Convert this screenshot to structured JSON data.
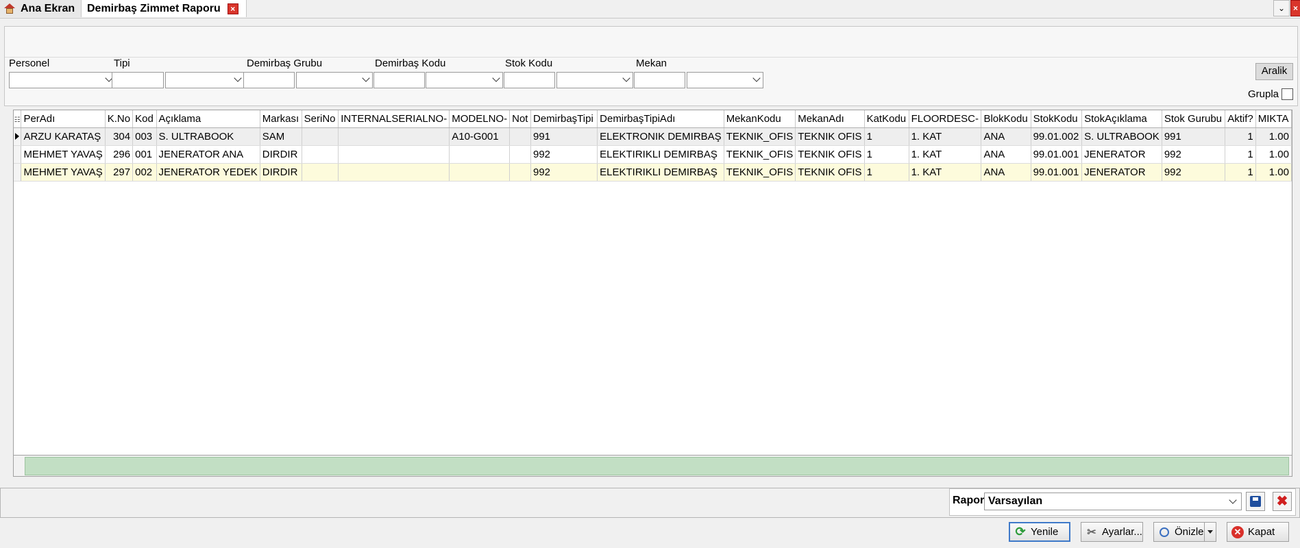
{
  "tabs": {
    "home_label": "Ana Ekran",
    "active_label": "Demirbaş Zimmet Raporu"
  },
  "filters": {
    "personel_label": "Personel",
    "tipi_label": "Tipi",
    "demirbas_grubu_label": "Demirbaş Grubu",
    "demirbas_kodu_label": "Demirbaş Kodu",
    "stok_kodu_label": "Stok Kodu",
    "mekan_label": "Mekan",
    "aralik_label": "Aralik",
    "grupla_label": "Grupla"
  },
  "grid": {
    "columns": [
      "PerAdı",
      "K.No",
      "Kod",
      "Açıklama",
      "Markası",
      "SeriNo",
      "INTERNALSERIALNO-",
      "MODELNO-",
      "Not",
      "DemirbaşTipi",
      "DemirbaşTipiAdı",
      "MekanKodu",
      "MekanAdı",
      "KatKodu",
      "FLOORDESC-",
      "BlokKodu",
      "StokKodu",
      "StokAçıklama",
      "Stok Gurubu",
      "Aktif?",
      "MIKTA"
    ],
    "rows": [
      [
        "ARZU KARATAŞ",
        "304",
        "003",
        "S. ULTRABOOK",
        "SAM",
        "",
        "",
        "A10-G001",
        "",
        "991",
        "ELEKTRONIK DEMIRBAŞ",
        "TEKNIK_OFIS",
        "TEKNIK OFIS",
        "1",
        "1. KAT",
        "ANA",
        "99.01.002",
        "S. ULTRABOOK",
        "991",
        "1",
        "1.00"
      ],
      [
        "MEHMET YAVAŞ",
        "296",
        "001",
        "JENERATOR ANA",
        "DIRDIR",
        "",
        "",
        "",
        "",
        "992",
        "ELEKTIRIKLI DEMIRBAŞ",
        "TEKNIK_OFIS",
        "TEKNIK OFIS",
        "1",
        "1. KAT",
        "ANA",
        "99.01.001",
        "JENERATOR",
        "992",
        "1",
        "1.00"
      ],
      [
        "MEHMET YAVAŞ",
        "297",
        "002",
        "JENERATOR YEDEK",
        "DIRDIR",
        "",
        "",
        "",
        "",
        "992",
        "ELEKTIRIKLI DEMIRBAŞ",
        "TEKNIK_OFIS",
        "TEKNIK OFIS",
        "1",
        "1. KAT",
        "ANA",
        "99.01.001",
        "JENERATOR",
        "992",
        "1",
        "1.00"
      ]
    ]
  },
  "rapor": {
    "label": "Rapor",
    "selected": "Varsayılan"
  },
  "buttons": {
    "yenile": "Yenile",
    "ayarlar": "Ayarlar...",
    "onizle": "Önizle",
    "kapat": "Kapat"
  },
  "colors": {
    "footer_green": "#c2dfc4",
    "highlight_row": "#fdfbdc",
    "close_red": "#d9352b"
  }
}
